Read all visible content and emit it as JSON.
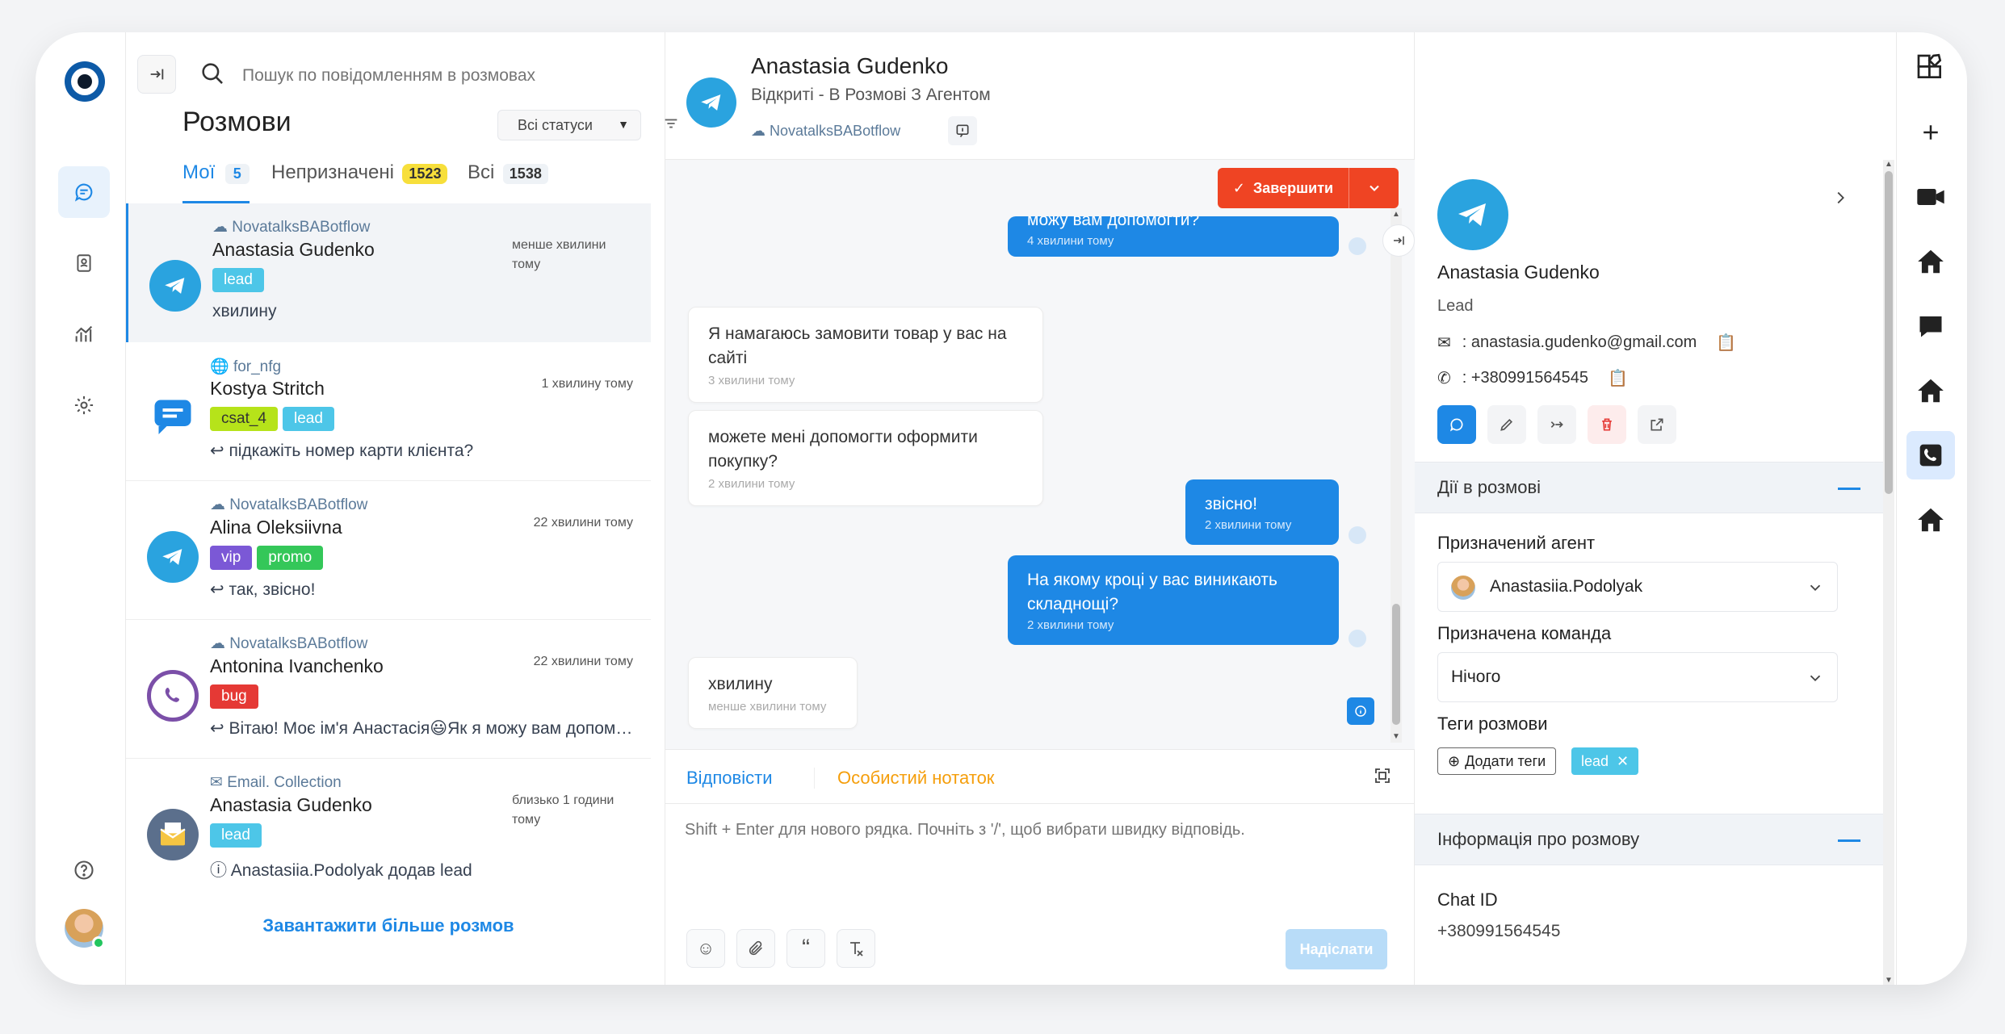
{
  "search": {
    "placeholder": "Пошук по повідомленням в розмовах"
  },
  "conversations": {
    "title": "Розмови",
    "status_filter": "Всі статуси",
    "tabs": [
      {
        "label": "Мої",
        "count": "5"
      },
      {
        "label": "Непризначені",
        "count": "1523"
      },
      {
        "label": "Всі",
        "count": "1538"
      }
    ],
    "items": [
      {
        "source": "NovatalksBABotflow",
        "name": "Anastasia Gudenko",
        "tags": [
          "lead"
        ],
        "message": "хвилину",
        "time": "менше хвилини тому",
        "avatar": "telegram-icon"
      },
      {
        "source": "for_nfg",
        "name": "Kostya Stritch",
        "tags": [
          "csat_4",
          "lead"
        ],
        "message": "підкажіть номер карти клієнта?",
        "time": "1 хвилину тому",
        "avatar": "chat-icon"
      },
      {
        "source": "NovatalksBABotflow",
        "name": "Alina Oleksiivna",
        "tags": [
          "vip",
          "promo"
        ],
        "message": "так, звісно!",
        "time": "22 хвилини тому",
        "avatar": "telegram-icon"
      },
      {
        "source": "NovatalksBABotflow",
        "name": "Antonina Ivanchenko",
        "tags": [
          "bug"
        ],
        "message": "Вітаю! Моє ім'я Анастасія😃Як я можу вам допом…",
        "time": "22 хвилини тому",
        "avatar": "viber-icon"
      },
      {
        "source": "Email. Collection",
        "name": "Anastasia Gudenko",
        "tags": [
          "lead"
        ],
        "message": "Anastasiia.Podolyak додав lead",
        "time": "близько 1 години тому",
        "avatar": "email-icon"
      }
    ],
    "load_more": "Завантажити більше розмов"
  },
  "tag_colors": {
    "lead": "#4dc6e8",
    "csat_4": "#b6e31a",
    "vip": "#7b58d6",
    "promo": "#34c759",
    "bug": "#e53935"
  },
  "chat": {
    "name": "Anastasia Gudenko",
    "status": "Відкриті - В Розмові З Агентом",
    "inbox": "NovatalksBABotflow",
    "resolve_label": "Завершити",
    "messages": [
      {
        "dir": "out",
        "text": "можу вам допомогти?",
        "time": "4 хвилини тому"
      },
      {
        "dir": "in",
        "text": "Я намагаюсь замовити товар у вас на сайті",
        "time": "3 хвилини тому"
      },
      {
        "dir": "in",
        "text": "можете мені допомогти оформити покупку?",
        "time": "2 хвилини тому"
      },
      {
        "dir": "out",
        "text": "звісно!",
        "time": "2 хвилини тому"
      },
      {
        "dir": "out",
        "text": "На якому кроці у вас виникають складнощі?",
        "time": "2 хвилини тому"
      },
      {
        "dir": "in",
        "text": "хвилину",
        "time": "менше хвилини тому"
      }
    ],
    "reply_tab": "Відповісти",
    "note_tab": "Особистий нотаток",
    "composer_placeholder": "Shift + Enter для нового рядка. Почніть з '/', щоб вибрати швидку відповідь.",
    "send_label": "Надіслати"
  },
  "contact": {
    "name": "Anastasia Gudenko",
    "role": "Lead",
    "email": ": anastasia.gudenko@gmail.com",
    "phone": ": +380991564545",
    "actions_title": "Дії в розмові",
    "agent_label": "Призначений агент",
    "agent_value": "Anastasiia.Podolyak",
    "team_label": "Призначена команда",
    "team_value": "Нічого",
    "tags_label": "Теги розмови",
    "add_tags": "Додати теги",
    "tag": "lead",
    "info_title": "Інформація про розмову",
    "chat_id_label": "Chat ID",
    "chat_id_value": "+380991564545"
  }
}
